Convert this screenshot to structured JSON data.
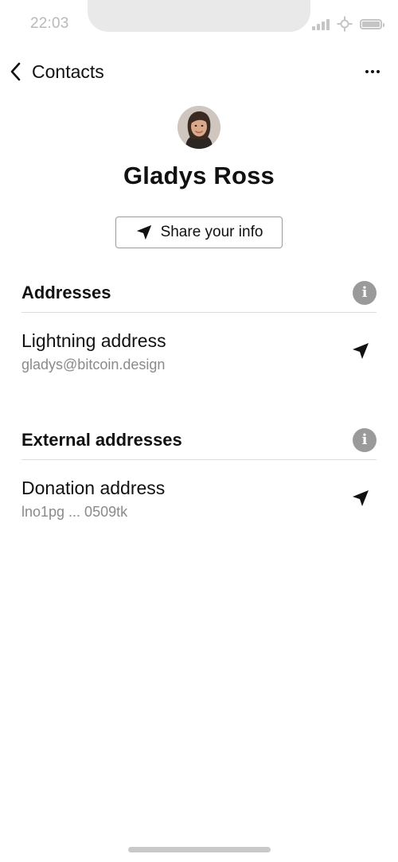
{
  "status_bar": {
    "time": "22:03",
    "icons": [
      "cellular-signal-icon",
      "network-icon",
      "battery-icon"
    ]
  },
  "nav": {
    "back_label": "Contacts",
    "back_icon": "chevron-left-icon",
    "more_icon": "more-horizontal-icon"
  },
  "contact": {
    "name": "Gladys Ross",
    "avatar": "contact-photo"
  },
  "share_button": {
    "label": "Share your info",
    "icon": "send-icon"
  },
  "sections": [
    {
      "title": "Addresses",
      "info_icon": "info-icon",
      "items": [
        {
          "label": "Lightning address",
          "value": "gladys@bitcoin.design",
          "icon": "send-icon"
        }
      ]
    },
    {
      "title": "External addresses",
      "info_icon": "info-icon",
      "items": [
        {
          "label": "Donation address",
          "value": "lno1pg ... 0509tk",
          "icon": "send-icon"
        }
      ]
    }
  ],
  "colors": {
    "text": "#111111",
    "secondary_text": "#8a8a8a",
    "info_icon_bg": "#9a9a9a",
    "divider": "#dcdcdc",
    "notch": "#e9e9ea"
  }
}
